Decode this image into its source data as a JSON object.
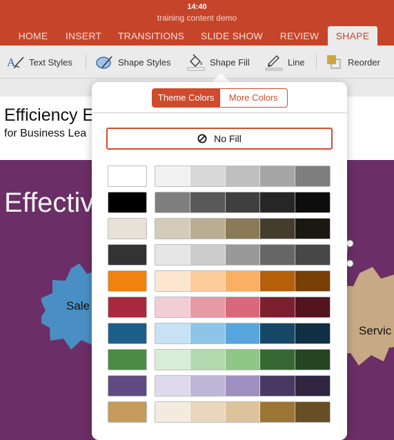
{
  "status": {
    "time": "14:40"
  },
  "document": {
    "title": "training content demo"
  },
  "tabs": [
    {
      "label": "HOME"
    },
    {
      "label": "INSERT"
    },
    {
      "label": "TRANSITIONS"
    },
    {
      "label": "SLIDE SHOW"
    },
    {
      "label": "REVIEW"
    },
    {
      "label": "SHAPE",
      "active": true
    }
  ],
  "toolbar": {
    "text_styles": "Text Styles",
    "shape_styles": "Shape Styles",
    "shape_fill": "Shape Fill",
    "line": "Line",
    "reorder": "Reorder"
  },
  "slide": {
    "title": "Efficiency E",
    "subtitle": "for Business Lea",
    "big_text": "Effectiv",
    "gear_left_label": "Sale",
    "gear_right_label": "Servic"
  },
  "popover": {
    "segments": [
      "Theme Colors",
      "More Colors"
    ],
    "active_segment": "Theme Colors",
    "no_fill_label": "No Fill",
    "accent_color": "#d04a2c",
    "palette": [
      {
        "base": "#ffffff",
        "shades": [
          "#f2f2f2",
          "#d8d8d8",
          "#bfbfbf",
          "#a5a5a5",
          "#7f7f7f"
        ]
      },
      {
        "base": "#000000",
        "shades": [
          "#7f7f7f",
          "#595959",
          "#3f3f3f",
          "#262626",
          "#0d0d0d"
        ]
      },
      {
        "base": "#e7e1d8",
        "shades": [
          "#d4cbb9",
          "#b9ad91",
          "#8a7a55",
          "#453d2b",
          "#1b1812"
        ]
      },
      {
        "base": "#333333",
        "shades": [
          "#e6e6e6",
          "#cccccc",
          "#999999",
          "#666666",
          "#474747"
        ]
      },
      {
        "base": "#f0820f",
        "shades": [
          "#fde6cf",
          "#fbcb9a",
          "#f9b065",
          "#b45f0a",
          "#783f07"
        ]
      },
      {
        "base": "#a6293e",
        "shades": [
          "#f2cdd4",
          "#e59aa6",
          "#d8687a",
          "#7c1f2e",
          "#53141f"
        ]
      },
      {
        "base": "#1d5f89",
        "shades": [
          "#c7e2f4",
          "#8fc4e9",
          "#57a6de",
          "#174766",
          "#0f2f44"
        ]
      },
      {
        "base": "#4a8a45",
        "shades": [
          "#d9ecd7",
          "#b3d9af",
          "#8dc687",
          "#376834",
          "#254522"
        ]
      },
      {
        "base": "#614b82",
        "shades": [
          "#dfdaeb",
          "#bfb5d6",
          "#9f90c2",
          "#493862",
          "#302641"
        ]
      },
      {
        "base": "#c59a5b",
        "shades": [
          "#f3ebde",
          "#e8d7bd",
          "#dcc39c",
          "#9a7536",
          "#674e24"
        ]
      }
    ]
  }
}
